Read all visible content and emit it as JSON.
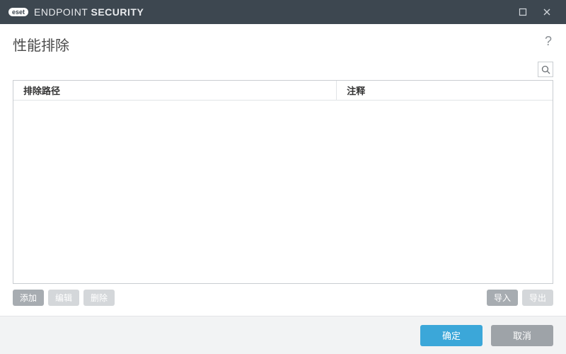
{
  "titlebar": {
    "badge": "eset",
    "product_light": "ENDPOINT ",
    "product_bold": "SECURITY"
  },
  "page": {
    "title": "性能排除"
  },
  "table": {
    "col_path": "排除路径",
    "col_comment": "注释",
    "rows": []
  },
  "actions": {
    "add": "添加",
    "edit": "编辑",
    "delete": "删除",
    "import": "导入",
    "export": "导出"
  },
  "footer": {
    "ok": "确定",
    "cancel": "取消"
  }
}
